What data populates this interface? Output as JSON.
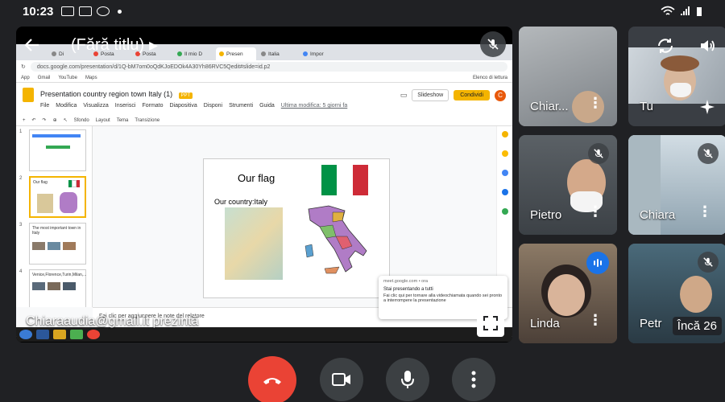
{
  "status_bar": {
    "time": "10:23"
  },
  "meeting": {
    "title": "(Fără titlu)"
  },
  "presenter": {
    "label": "Chiaraaudia@gmail.it prezintă"
  },
  "browser": {
    "tabs": [
      "Di",
      "Posta",
      "Posta",
      "Il mio D",
      "Presen",
      "Italia",
      "Impor"
    ],
    "url": "docs.google.com/presentation/d/1Q-bM7om0oQdKJoEDOk4A30Yh86RVC5Qedit#slide=id.p2",
    "bookmarks": [
      "App",
      "Gmail",
      "YouTube",
      "Maps"
    ],
    "reading_list": "Elenco di lettura"
  },
  "slides": {
    "doc_title": "Presentation country region town Italy (1)",
    "ppt_badge": "PPT",
    "menus": [
      "File",
      "Modifica",
      "Visualizza",
      "Inserisci",
      "Formato",
      "Diapositiva",
      "Disponi",
      "Strumenti",
      "Guida"
    ],
    "last_edit": "Ultima modifica: 5 giorni fa",
    "slideshow_label": "Slideshow",
    "share_label": "Condividi",
    "avatar_letter": "C",
    "toolbar": [
      "Sfondo",
      "Layout",
      "Tema",
      "Transizione"
    ],
    "notes_placeholder": "Fai clic per aggiungere le note del relatore",
    "thumbnails": [
      {
        "num": "1",
        "text": ""
      },
      {
        "num": "2",
        "text": "Our flag"
      },
      {
        "num": "3",
        "text": "The most important town in Italy"
      },
      {
        "num": "4",
        "text": "Venice,Florence,Turin,Milan,..."
      }
    ],
    "current_slide": {
      "title": "Our flag",
      "subtitle": "Our country:Italy"
    }
  },
  "notification": {
    "source": "meet.google.com • ora",
    "title": "Stai presentando a tutti",
    "body": "Fai clic qui per tornare alla videochiamata quando sei pronto a interrompere la presentazione"
  },
  "participants": [
    {
      "name": "Chiar...",
      "muted": false
    },
    {
      "name": "Tu",
      "muted": false
    },
    {
      "name": "Pietro",
      "muted": true
    },
    {
      "name": "Chiara",
      "muted": true
    },
    {
      "name": "Linda",
      "muted": false,
      "speaking": true
    },
    {
      "name": "Petr",
      "muted": true
    }
  ],
  "more_participants": "Încă 26",
  "colors": {
    "end_call": "#ea4335",
    "speaking": "#1a73e8",
    "slides_yellow": "#f4b400"
  }
}
